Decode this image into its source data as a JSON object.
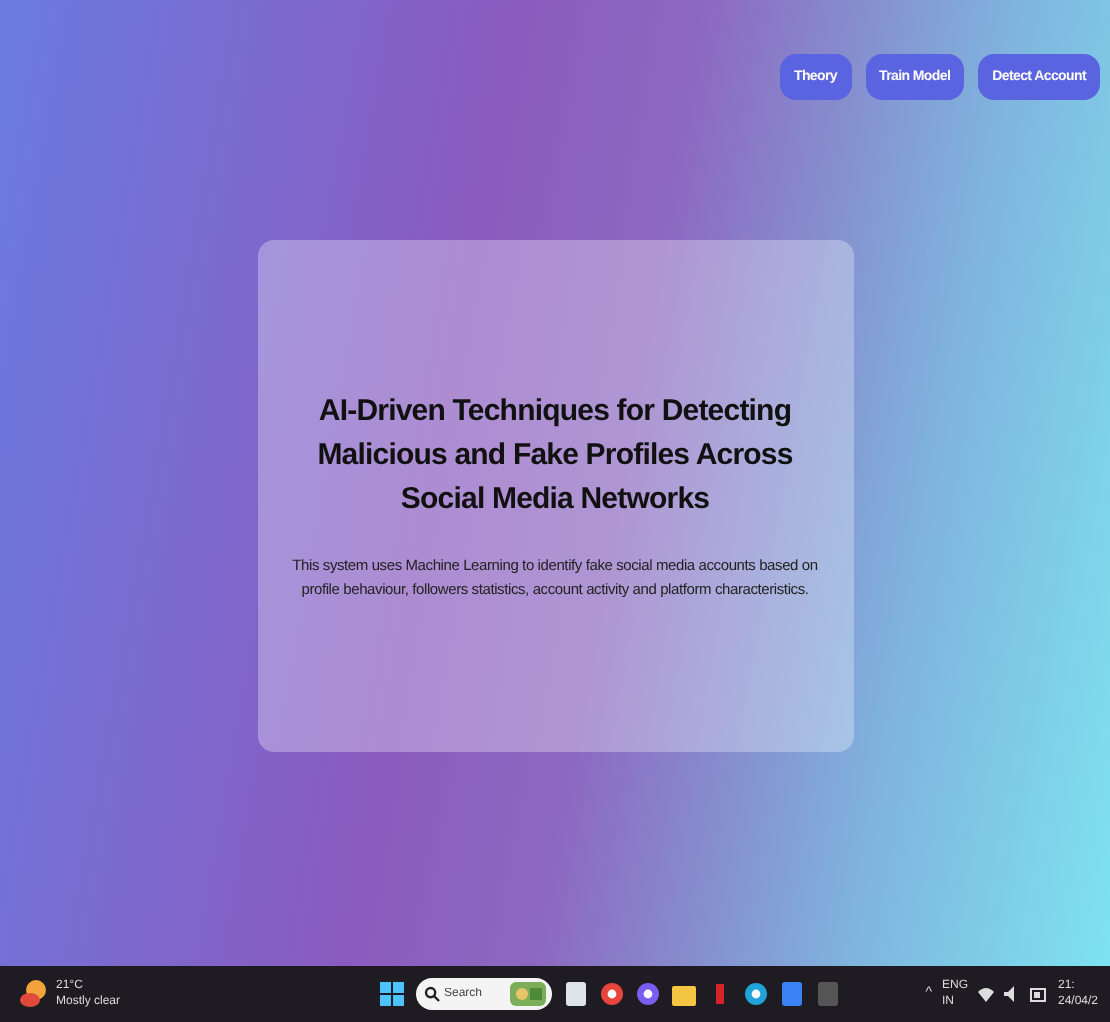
{
  "nav": {
    "buttons": [
      {
        "label": "Theory"
      },
      {
        "label": "Train Model"
      },
      {
        "label": "Detect Account"
      }
    ]
  },
  "hero": {
    "title": "AI-Driven Techniques for Detecting Malicious and Fake Profiles Across Social Media Networks",
    "description": "This system uses Machine Learning to identify fake social media accounts based on profile behaviour, followers statistics, account activity and platform characteristics."
  },
  "taskbar": {
    "weather": {
      "temperature": "21°C",
      "condition": "Mostly clear"
    },
    "search": {
      "placeholder": "Search"
    },
    "apps": [
      {
        "kind": "files"
      },
      {
        "kind": "chrome"
      },
      {
        "kind": "copilot"
      },
      {
        "kind": "folder"
      },
      {
        "kind": "red"
      },
      {
        "kind": "edge"
      },
      {
        "kind": "store"
      },
      {
        "kind": "terminal"
      }
    ],
    "tray": {
      "chevron": "^",
      "language": "ENG",
      "region": "IN",
      "time": "21:",
      "date": "24/04/2"
    }
  }
}
